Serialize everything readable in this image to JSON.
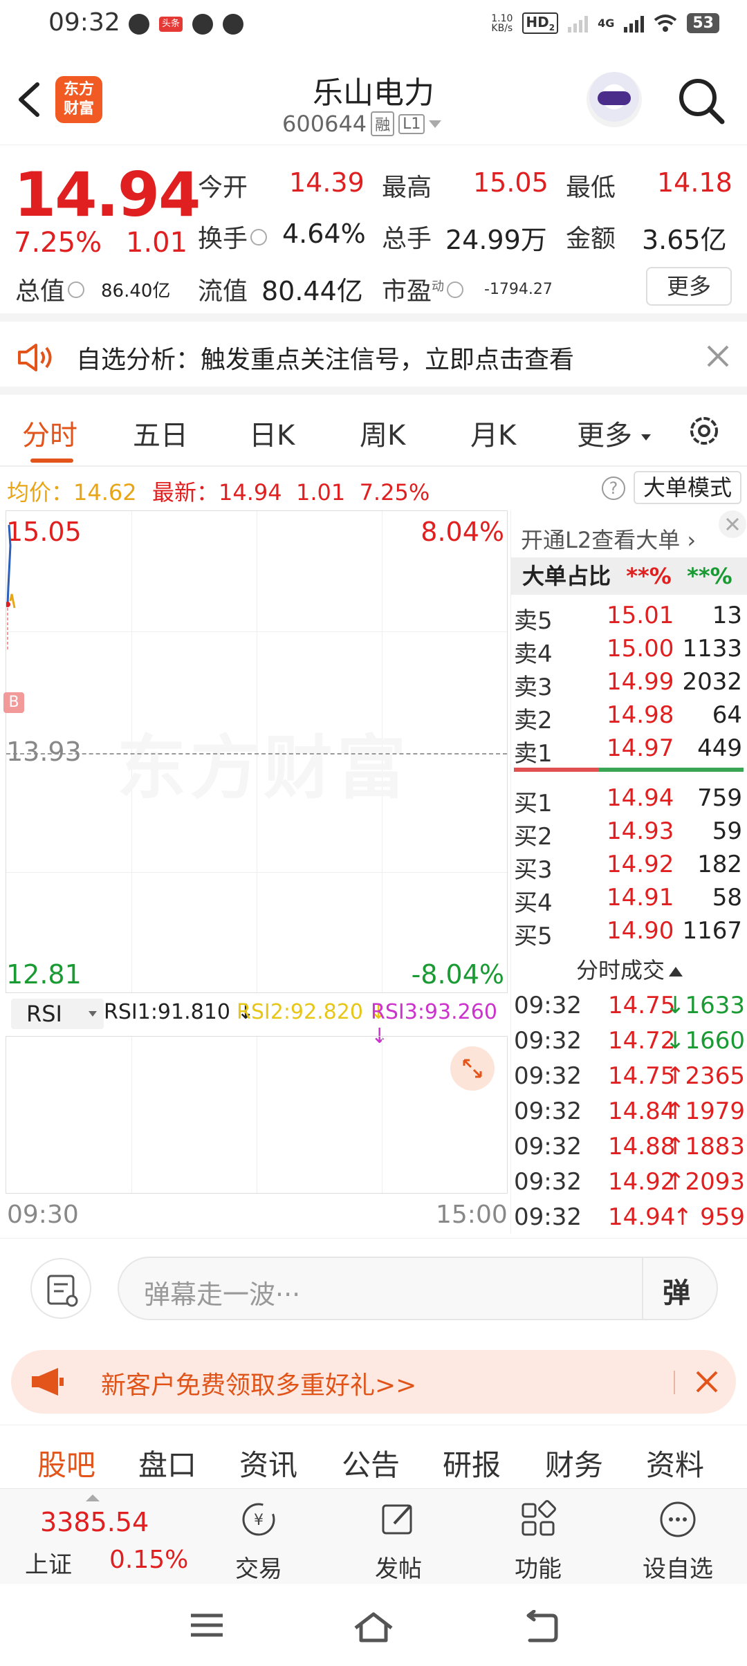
{
  "status_bar": {
    "time": "09:32",
    "notif_tag": "头条",
    "net_speed_value": "1.10",
    "net_speed_unit": "KB/s",
    "hd": "HD",
    "hd_sub": "2",
    "network": "4G",
    "battery": "53"
  },
  "header": {
    "logo_line1": "东方",
    "logo_line2": "财富",
    "title": "乐山电力",
    "code": "600644",
    "badge1": "融",
    "badge2": "L1"
  },
  "quote": {
    "price": "14.94",
    "change_pct": "7.25%",
    "change": "1.01",
    "open_label": "今开",
    "open": "14.39",
    "high_label": "最高",
    "high": "15.05",
    "low_label": "最低",
    "low": "14.18",
    "turnover_label": "换手",
    "turnover": "4.64%",
    "volume_label": "总手",
    "volume": "24.99万",
    "amount_label": "金额",
    "amount": "3.65亿",
    "mktcap_label": "总值",
    "mktcap": "86.40亿",
    "float_label": "流值",
    "float_cap": "80.44亿",
    "pe_label": "市盈",
    "pe_sup": "动",
    "pe": "-1794.27",
    "more": "更多"
  },
  "notice": {
    "text": "自选分析：触发重点关注信号，立即点击查看"
  },
  "tabs": {
    "items": [
      "分时",
      "五日",
      "日K",
      "周K",
      "月K",
      "更多"
    ],
    "active": 0
  },
  "infoline": {
    "avg_label": "均价：",
    "avg": "14.62",
    "latest_label": "最新：",
    "latest": "14.94",
    "latest_change": "1.01",
    "latest_pct": "7.25%",
    "help": "?",
    "mode_button": "大单模式"
  },
  "chart": {
    "top_price": "15.05",
    "top_pct": "8.04%",
    "mid_price": "13.93",
    "bottom_price": "12.81",
    "bottom_pct": "-8.04%",
    "watermark": "东方财富",
    "b_marker": "B",
    "start_time": "09:30",
    "end_time": "15:00"
  },
  "rsi": {
    "selector": "RSI",
    "rsi1": "RSI1:91.810",
    "rsi2": "RSI2:92.820",
    "rsi3": "RSI3:93.260"
  },
  "order_book": {
    "l2_link": "开通L2查看大单",
    "big_ratio_label": "大单占比",
    "big_ratio_buy": "**%",
    "big_ratio_sell": "**%",
    "asks": [
      {
        "label": "卖5",
        "price": "15.01",
        "vol": "13"
      },
      {
        "label": "卖4",
        "price": "15.00",
        "vol": "1133"
      },
      {
        "label": "卖3",
        "price": "14.99",
        "vol": "2032"
      },
      {
        "label": "卖2",
        "price": "14.98",
        "vol": "64"
      },
      {
        "label": "卖1",
        "price": "14.97",
        "vol": "449"
      }
    ],
    "bids": [
      {
        "label": "买1",
        "price": "14.94",
        "vol": "759"
      },
      {
        "label": "买2",
        "price": "14.93",
        "vol": "59"
      },
      {
        "label": "买3",
        "price": "14.92",
        "vol": "182"
      },
      {
        "label": "买4",
        "price": "14.91",
        "vol": "58"
      },
      {
        "label": "买5",
        "price": "14.90",
        "vol": "1167"
      }
    ],
    "ticks_title": "分时成交",
    "ticks": [
      {
        "time": "09:32",
        "price": "14.75",
        "vol": "↓1633"
      },
      {
        "time": "09:32",
        "price": "14.72",
        "vol": "↓1660"
      },
      {
        "time": "09:32",
        "price": "14.75",
        "vol": "↑2365"
      },
      {
        "time": "09:32",
        "price": "14.84",
        "vol": "↑1979"
      },
      {
        "time": "09:32",
        "price": "14.88",
        "vol": "↑1883"
      },
      {
        "time": "09:32",
        "price": "14.92",
        "vol": "↑2093"
      },
      {
        "time": "09:32",
        "price": "14.94",
        "vol": "↑ 959"
      }
    ]
  },
  "danmu": {
    "placeholder": "弹幕走一波···",
    "button": "弹"
  },
  "promo": {
    "text": "新客户免费领取多重好礼>>"
  },
  "bottom_tabs": [
    "股吧",
    "盘口",
    "资讯",
    "公告",
    "研报",
    "财务",
    "资料"
  ],
  "bottom_nav": {
    "index_value": "3385.54",
    "index_name": "上证",
    "index_pct": "0.15%",
    "items": [
      "交易",
      "发帖",
      "功能",
      "设自选"
    ]
  },
  "colors": {
    "up": "#e02020",
    "down": "#1a9a33",
    "accent": "#e2541a",
    "avg_line": "#e8a617"
  }
}
